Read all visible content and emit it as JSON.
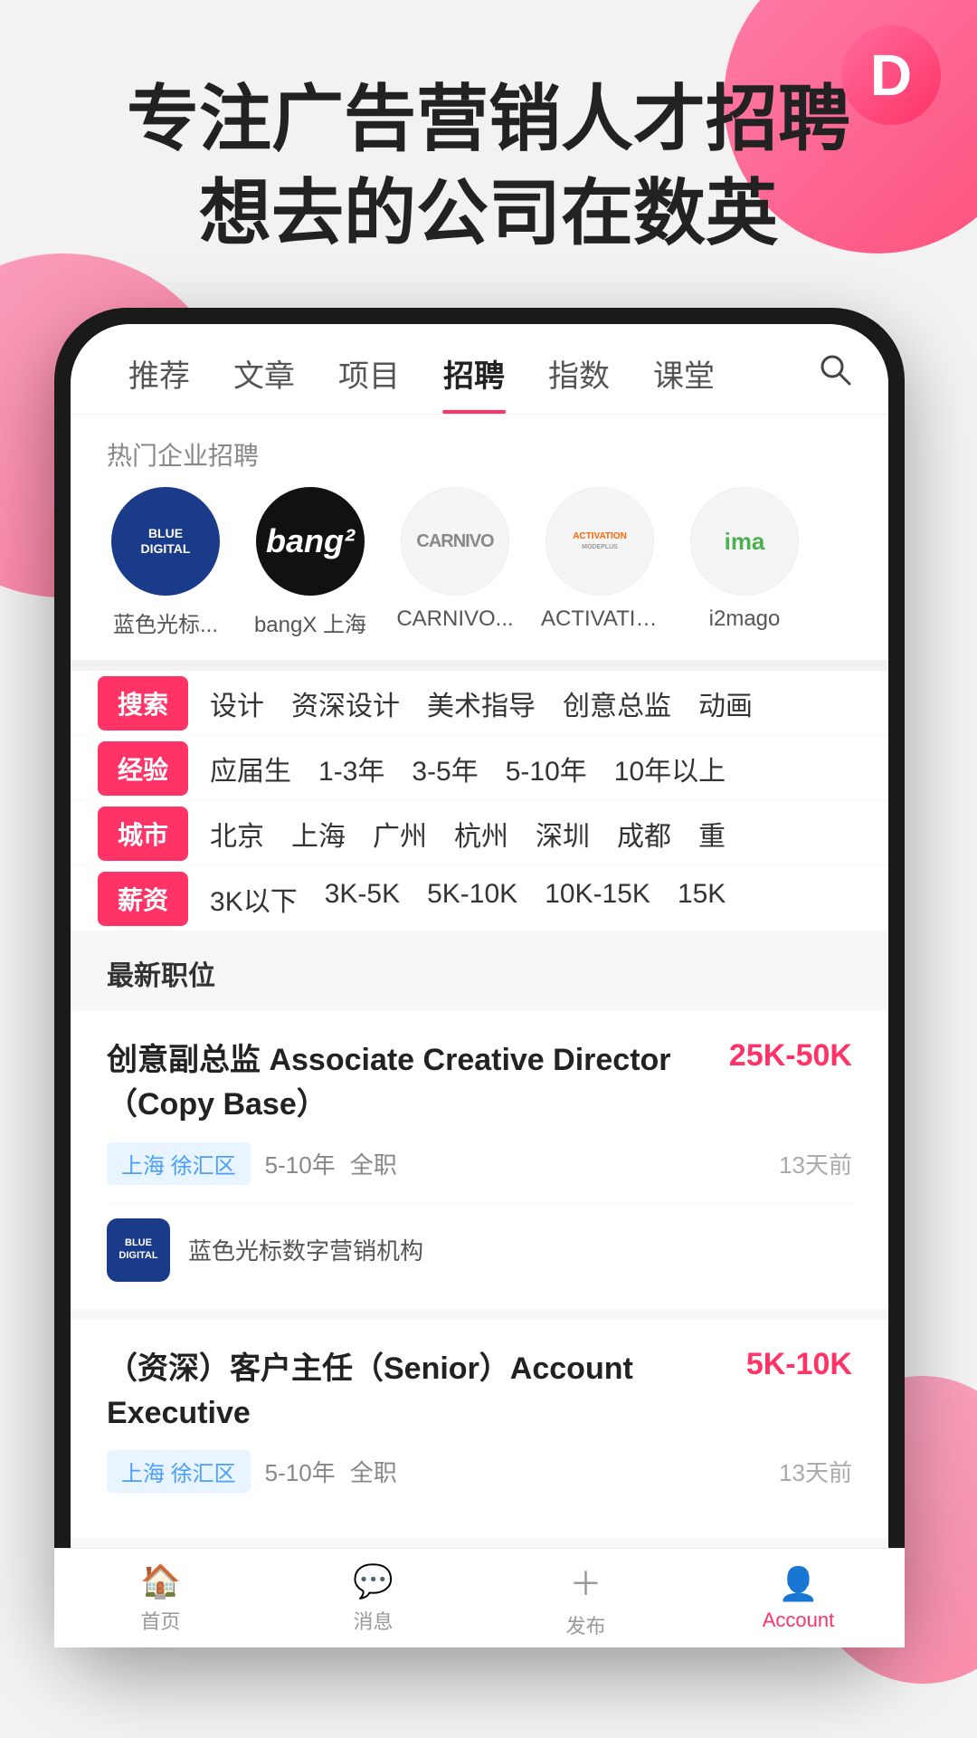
{
  "app": {
    "logo_letter": "D"
  },
  "hero": {
    "line1": "专注广告营销人才招聘",
    "line2": "想去的公司在数英"
  },
  "nav": {
    "items": [
      {
        "label": "推荐",
        "active": false
      },
      {
        "label": "文章",
        "active": false
      },
      {
        "label": "项目",
        "active": false
      },
      {
        "label": "招聘",
        "active": true
      },
      {
        "label": "指数",
        "active": false
      },
      {
        "label": "课堂",
        "active": false
      }
    ]
  },
  "hot_companies": {
    "label": "热门企业招聘",
    "items": [
      {
        "name": "蓝色光标...",
        "logo_type": "blue-digital",
        "logo_text": "BLUE\nDIGITAL"
      },
      {
        "name": "bangX 上海",
        "logo_type": "bangx",
        "logo_text": "bang²"
      },
      {
        "name": "CARNIVO...",
        "logo_type": "carnivo",
        "logo_text": "CARNIVO"
      },
      {
        "name": "ACTIVATIO...",
        "logo_type": "activation",
        "logo_text": "ACTIVATION"
      },
      {
        "name": "i2mago",
        "logo_type": "i2mago",
        "logo_text": "ima"
      }
    ]
  },
  "filters": [
    {
      "tag": "搜索",
      "options": [
        "设计",
        "资深设计",
        "美术指导",
        "创意总监",
        "动画"
      ]
    },
    {
      "tag": "经验",
      "options": [
        "应届生",
        "1-3年",
        "3-5年",
        "5-10年",
        "10年以上"
      ]
    },
    {
      "tag": "城市",
      "options": [
        "北京",
        "上海",
        "广州",
        "杭州",
        "深圳",
        "成都",
        "重"
      ]
    },
    {
      "tag": "薪资",
      "options": [
        "3K以下",
        "3K-5K",
        "5K-10K",
        "10K-15K",
        "15K"
      ]
    }
  ],
  "jobs_section_label": "最新职位",
  "jobs": [
    {
      "title": "创意副总监 Associate Creative Director（Copy Base）",
      "salary": "25K-50K",
      "location": "上海 徐汇区",
      "exp": "5-10年",
      "type": "全职",
      "time": "13天前",
      "company_name": "蓝色光标数字营销机构",
      "company_logo_type": "blue-digital"
    },
    {
      "title": "（资深）客户主任（Senior）Account Executive",
      "salary": "5K-10K",
      "location": "上海 徐汇区",
      "exp": "5-10年",
      "type": "全职",
      "time": "13天前",
      "company_name": "",
      "company_logo_type": ""
    }
  ],
  "bottom_nav": {
    "items": [
      {
        "label": "首页",
        "icon": "🏠",
        "active": false
      },
      {
        "label": "消息",
        "icon": "💬",
        "active": false
      },
      {
        "label": "发布",
        "icon": "＋",
        "active": false
      },
      {
        "label": "Account",
        "icon": "👤",
        "active": true
      }
    ]
  }
}
